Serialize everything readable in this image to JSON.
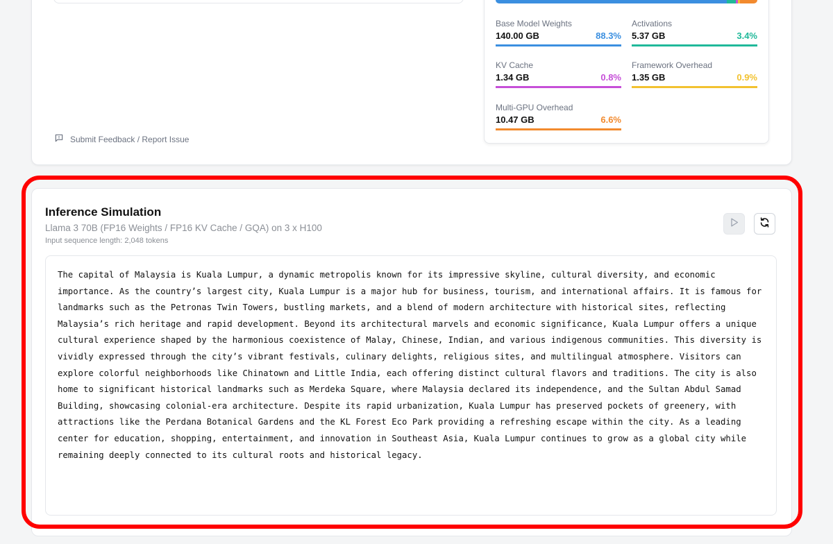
{
  "feedback": {
    "label": "Submit Feedback / Report Issue",
    "icon": "message-icon"
  },
  "memory_breakdown": {
    "total_bar": [
      {
        "name": "Base Model Weights",
        "percent": 88.3,
        "color": "#3b8fe0"
      },
      {
        "name": "Activations",
        "percent": 3.4,
        "color": "#20b99a"
      },
      {
        "name": "KV Cache",
        "percent": 0.8,
        "color": "#c64fd8"
      },
      {
        "name": "Framework Overhead",
        "percent": 0.9,
        "color": "#f2c230"
      },
      {
        "name": "Multi-GPU Overhead",
        "percent": 6.6,
        "color": "#f28a2e"
      }
    ],
    "items": [
      {
        "label": "Base Model Weights",
        "value": "140.00 GB",
        "percent": "88.3%",
        "color": "#3b8fe0"
      },
      {
        "label": "Activations",
        "value": "5.37 GB",
        "percent": "3.4%",
        "color": "#20b99a"
      },
      {
        "label": "KV Cache",
        "value": "1.34 GB",
        "percent": "0.8%",
        "color": "#c64fd8"
      },
      {
        "label": "Framework Overhead",
        "value": "1.35 GB",
        "percent": "0.9%",
        "color": "#f2c230"
      },
      {
        "label": "Multi-GPU Overhead",
        "value": "10.47 GB",
        "percent": "6.6%",
        "color": "#f28a2e"
      }
    ]
  },
  "inference": {
    "title": "Inference Simulation",
    "subtitle": "Llama 3 70B (FP16 Weights / FP16 KV Cache / GQA) on 3 x H100",
    "meta": "Input sequence length: 2,048 tokens",
    "play_icon": "play-icon",
    "reset_icon": "refresh-icon",
    "output": "The capital of Malaysia is Kuala Lumpur, a dynamic metropolis known for its impressive skyline, cultural diversity, and economic importance. As the country’s largest city, Kuala Lumpur is a major hub for business, tourism, and international affairs. It is famous for landmarks such as the Petronas Twin Towers, bustling markets, and a blend of modern architecture with historical sites, reflecting Malaysia’s rich heritage and rapid development. Beyond its architectural marvels and economic significance, Kuala Lumpur offers a unique cultural experience shaped by the harmonious coexistence of Malay, Chinese, Indian, and various indigenous communities. This diversity is vividly expressed through the city’s vibrant festivals, culinary delights, religious sites, and multilingual atmosphere. Visitors can explore colorful neighborhoods like Chinatown and Little India, each offering distinct cultural flavors and traditions. The city is also home to significant historical landmarks such as Merdeka Square, where Malaysia declared its independence, and the Sultan Abdul Samad Building, showcasing colonial-era architecture. Despite its rapid urbanization, Kuala Lumpur has preserved pockets of greenery, with attractions like the Perdana Botanical Gardens and the KL Forest Eco Park providing a refreshing escape within the city. As a leading center for education, shopping, entertainment, and innovation in Southeast Asia, Kuala Lumpur continues to grow as a global city while remaining deeply connected to its cultural roots and historical legacy."
  },
  "colors": {
    "highlight": "#ff0000",
    "muted_text": "#8b8f96"
  }
}
